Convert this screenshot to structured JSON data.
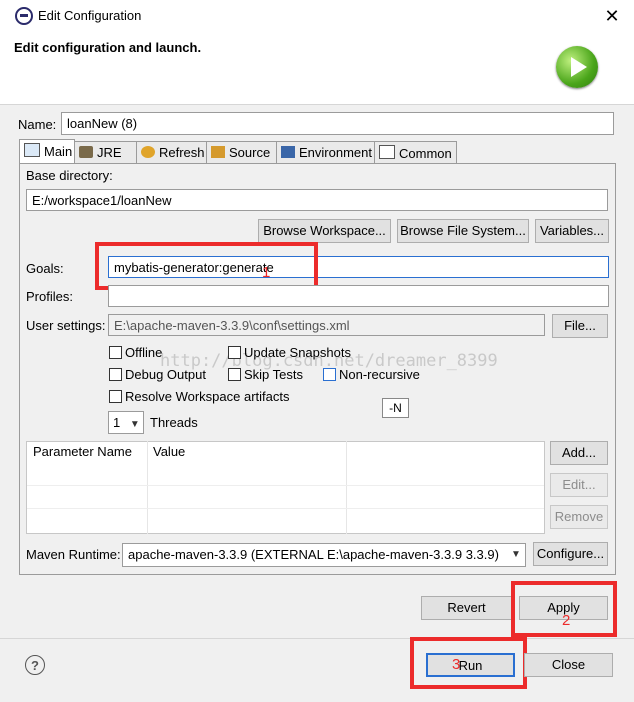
{
  "window": {
    "title": "Edit Configuration"
  },
  "banner": {
    "title": "Edit configuration and launch."
  },
  "name": {
    "label": "Name:",
    "value": "loanNew (8)"
  },
  "tabs": [
    {
      "label": "Main"
    },
    {
      "label": "JRE"
    },
    {
      "label": "Refresh"
    },
    {
      "label": "Source"
    },
    {
      "label": "Environment"
    },
    {
      "label": "Common"
    }
  ],
  "main": {
    "base_dir_label": "Base directory:",
    "base_dir_value": "E:/workspace1/loanNew",
    "browse_workspace": "Browse Workspace...",
    "browse_file_system": "Browse File System...",
    "variables": "Variables...",
    "goals_label": "Goals:",
    "goals_value": "mybatis-generator:generate",
    "profiles_label": "Profiles:",
    "profiles_value": "",
    "user_settings_label": "User settings:",
    "user_settings_value": "E:\\apache-maven-3.3.9\\conf\\settings.xml",
    "file_button": "File...",
    "offline": "Offline",
    "update_snapshots": "Update Snapshots",
    "debug_output": "Debug Output",
    "skip_tests": "Skip Tests",
    "non_recursive": "Non-recursive",
    "resolve_workspace": "Resolve Workspace artifacts",
    "threads_value": "1",
    "threads_label": "Threads",
    "tooltip": "-N",
    "watermark": "http://blog.csdn.net/dreamer_8399",
    "param_headers": [
      "Parameter Name",
      "Value"
    ],
    "add_button": "Add...",
    "edit_button": "Edit...",
    "remove_button": "Remove",
    "runtime_label": "Maven Runtime:",
    "runtime_value": "apache-maven-3.3.9 (EXTERNAL E:\\apache-maven-3.3.9 3.3.9)",
    "configure_button": "Configure..."
  },
  "footer": {
    "revert": "Revert",
    "apply": "Apply",
    "run": "Run",
    "close": "Close",
    "help": "?"
  },
  "annotations": {
    "n1": "1",
    "n2": "2",
    "n3": "3"
  },
  "colors": {
    "annotation_red": "#ec2b2b",
    "focus_blue": "#2a6fd1"
  }
}
